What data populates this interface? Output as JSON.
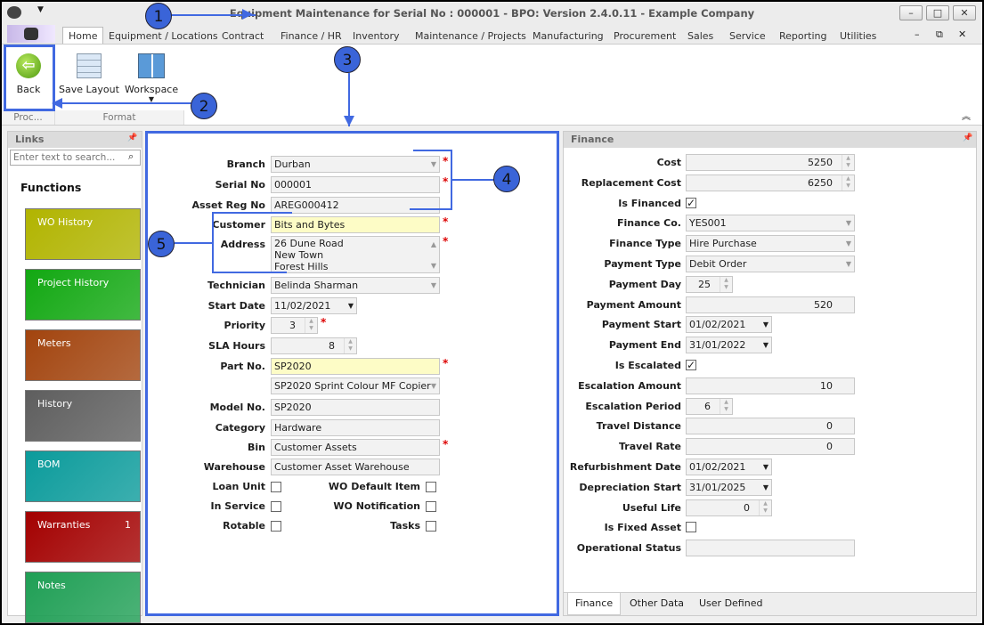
{
  "window": {
    "title": "Equipment Maintenance for Serial No : 000001 - BPO: Version 2.4.0.11 - Example Company",
    "minimize": "–",
    "maximize": "□",
    "close": "✕"
  },
  "tabs": [
    "Home",
    "Equipment / Locations",
    "Contract",
    "Finance / HR",
    "Inventory",
    "Maintenance / Projects",
    "Manufacturing",
    "Procurement",
    "Sales",
    "Service",
    "Reporting",
    "Utilities"
  ],
  "ribbon": {
    "back": "Back",
    "save_layout": "Save Layout",
    "workspace": "Workspace",
    "group_process": "Proc...",
    "group_format": "Format"
  },
  "links": {
    "header": "Links",
    "search_placeholder": "Enter text to search...",
    "functions": "Functions",
    "tiles": [
      {
        "label": "WO History",
        "color": "#b1b400"
      },
      {
        "label": "Project History",
        "color": "#12a812"
      },
      {
        "label": "Meters",
        "color": "#a2440e"
      },
      {
        "label": "History",
        "color": "#5e5e5e"
      },
      {
        "label": "BOM",
        "color": "#0b9b9b"
      },
      {
        "label": "Warranties",
        "color": "#a30000",
        "badge": "1"
      },
      {
        "label": "Notes",
        "color": "#1f9f55"
      }
    ]
  },
  "form": {
    "fields": [
      {
        "label": "Branch",
        "value": "Durban",
        "type": "select",
        "req": true
      },
      {
        "label": "Serial No",
        "value": "000001",
        "type": "text",
        "req": true
      },
      {
        "label": "Asset Reg No",
        "value": "AREG000412",
        "type": "text"
      },
      {
        "label": "Customer",
        "value": "Bits and Bytes",
        "type": "yellow",
        "req": true
      },
      {
        "label": "Address",
        "value": "26 Dune Road\nNew Town\nForest Hills",
        "type": "textarea",
        "req": true
      },
      {
        "label": "Technician",
        "value": "Belinda Sharman",
        "type": "select"
      },
      {
        "label": "Start Date",
        "value": "11/02/2021",
        "type": "date"
      },
      {
        "label": "Priority",
        "value": "3",
        "type": "spin",
        "req": true
      },
      {
        "label": "SLA Hours",
        "value": "8",
        "type": "spin"
      },
      {
        "label": "Part No.",
        "value": "SP2020",
        "type": "yellow",
        "req": true
      },
      {
        "label": "",
        "value": "SP2020 Sprint Colour MF Copier",
        "type": "select"
      },
      {
        "label": "Model No.",
        "value": "SP2020",
        "type": "text"
      },
      {
        "label": "Category",
        "value": "Hardware",
        "type": "text"
      },
      {
        "label": "Bin",
        "value": "Customer Assets",
        "type": "text",
        "req": true
      },
      {
        "label": "Warehouse",
        "value": "Customer Asset Warehouse",
        "type": "text"
      }
    ],
    "checks": [
      {
        "label": "Loan Unit",
        "checked": false
      },
      {
        "label": "WO Default Item",
        "checked": false
      },
      {
        "label": "In Service",
        "checked": false
      },
      {
        "label": "WO Notification",
        "checked": false
      },
      {
        "label": "Rotable",
        "checked": false
      },
      {
        "label": "Tasks",
        "checked": false
      }
    ]
  },
  "finance": {
    "header": "Finance",
    "fields": [
      {
        "label": "Cost",
        "value": "5250",
        "type": "spin"
      },
      {
        "label": "Replacement Cost",
        "value": "6250",
        "type": "spin"
      },
      {
        "label": "Is Financed",
        "value": true,
        "type": "check"
      },
      {
        "label": "Finance Co.",
        "value": "YES001",
        "type": "select"
      },
      {
        "label": "Finance Type",
        "value": "Hire Purchase",
        "type": "select"
      },
      {
        "label": "Payment Type",
        "value": "Debit Order",
        "type": "select"
      },
      {
        "label": "Payment Day",
        "value": "25",
        "type": "spin"
      },
      {
        "label": "Payment Amount",
        "value": "520",
        "type": "num"
      },
      {
        "label": "Payment Start",
        "value": "01/02/2021",
        "type": "date"
      },
      {
        "label": "Payment End",
        "value": "31/01/2022",
        "type": "date"
      },
      {
        "label": "Is Escalated",
        "value": true,
        "type": "check"
      },
      {
        "label": "Escalation Amount",
        "value": "10",
        "type": "num"
      },
      {
        "label": "Escalation Period",
        "value": "6",
        "type": "spin"
      },
      {
        "label": "Travel Distance",
        "value": "0",
        "type": "num"
      },
      {
        "label": "Travel Rate",
        "value": "0",
        "type": "num"
      },
      {
        "label": "Refurbishment Date",
        "value": "01/02/2021",
        "type": "date"
      },
      {
        "label": "Depreciation Start",
        "value": "31/01/2025",
        "type": "date"
      },
      {
        "label": "Useful Life",
        "value": "0",
        "type": "spin"
      },
      {
        "label": "Is Fixed Asset",
        "value": false,
        "type": "check"
      },
      {
        "label": "Operational Status",
        "value": "",
        "type": "text"
      }
    ],
    "bottom_tabs": [
      "Finance",
      "Other Data",
      "User Defined"
    ]
  },
  "annotations": [
    "1",
    "2",
    "3",
    "4",
    "5"
  ],
  "colors": {
    "annotation": "#3a64d8",
    "required": "#dd0000",
    "highlight": "#fdfcc6"
  }
}
